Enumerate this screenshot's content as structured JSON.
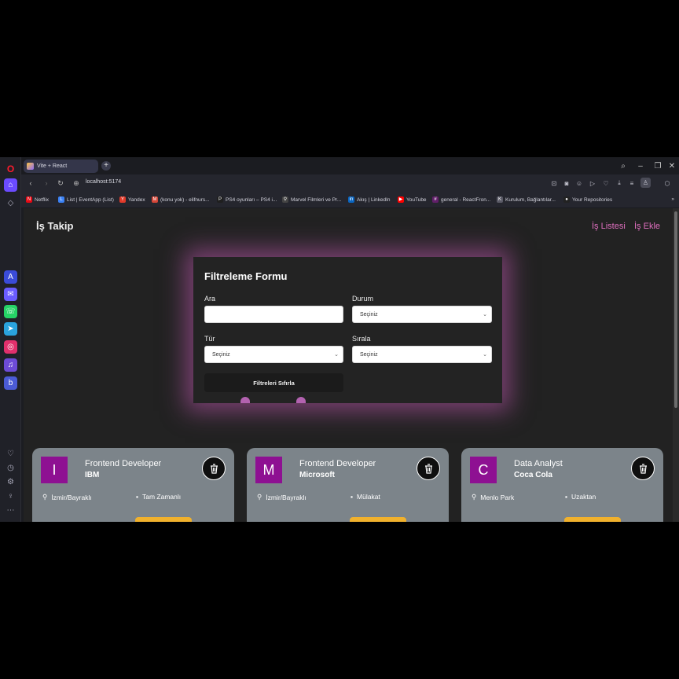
{
  "browser": {
    "tab_title": "Vite + React",
    "new_tab_label": "+",
    "url": "localhost:5174",
    "bookmarks": [
      {
        "label": "Netflix",
        "icon": "netflix-icon",
        "color": "#e50914",
        "glyph": "N"
      },
      {
        "label": "List | EventApp (List)",
        "icon": "page-icon",
        "color": "#3b82f6",
        "glyph": "L"
      },
      {
        "label": "Yandex",
        "icon": "yandex-icon",
        "color": "#e23a2a",
        "glyph": "Y"
      },
      {
        "label": "(konu yok) - elifnurs...",
        "icon": "gmail-icon",
        "color": "#d44638",
        "glyph": "M"
      },
      {
        "label": "PS4 oyunları – PS4 i...",
        "icon": "ps-icon",
        "color": "#1f1f1f",
        "glyph": "P"
      },
      {
        "label": "Marvel Filmleri ve Pr...",
        "icon": "marvel-icon",
        "color": "#444",
        "glyph": "⚲"
      },
      {
        "label": "Akış | LinkedIn",
        "icon": "linkedin-icon",
        "color": "#0a66c2",
        "glyph": "in"
      },
      {
        "label": "YouTube",
        "icon": "youtube-icon",
        "color": "#ff0000",
        "glyph": "▶"
      },
      {
        "label": "general - ReactFron...",
        "icon": "slack-icon",
        "color": "#611f69",
        "glyph": "#"
      },
      {
        "label": "Kurulum, Bağlantılar...",
        "icon": "doc-icon",
        "color": "#5a5a66",
        "glyph": "K"
      },
      {
        "label": "Your Repositories",
        "icon": "github-icon",
        "color": "#222",
        "glyph": "●"
      }
    ],
    "more_bookmarks": "»"
  },
  "app": {
    "brand": "İş Takip",
    "nav": {
      "list": "İş Listesi",
      "add": "İş Ekle"
    },
    "accent_color": "#e06fbf"
  },
  "filter_form": {
    "title": "Filtreleme Formu",
    "search_label": "Ara",
    "search_value": "",
    "status_label": "Durum",
    "status_value": "Seçiniz",
    "type_label": "Tür",
    "type_value": "Seçiniz",
    "sort_label": "Sırala",
    "sort_value": "Seçiniz",
    "reset_label": "Filtreleri Sıfırla"
  },
  "jobs": [
    {
      "initial": "I",
      "position": "Frontend Developer",
      "company": "IBM",
      "location": "İzmir/Bayraklı",
      "type": "Tam Zamanlı"
    },
    {
      "initial": "M",
      "position": "Frontend Developer",
      "company": "Microsoft",
      "location": "İzmir/Bayraklı",
      "type": "Mülakat"
    },
    {
      "initial": "C",
      "position": "Data Analyst",
      "company": "Coca Cola",
      "location": "Menlo Park",
      "type": "Uzaktan"
    }
  ]
}
